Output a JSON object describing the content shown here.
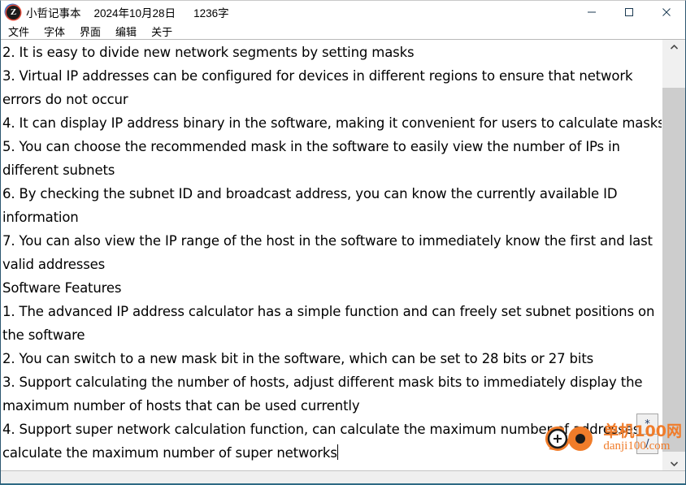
{
  "window": {
    "app_icon_letter": "Z",
    "title": "小哲记事本",
    "date": "2024年10月28日",
    "word_count": "1236字",
    "controls": {
      "minimize": "minimize-icon",
      "maximize": "maximize-icon",
      "close": "close-icon"
    }
  },
  "menubar": {
    "items": [
      {
        "label": "文件"
      },
      {
        "label": "字体"
      },
      {
        "label": "界面"
      },
      {
        "label": "编辑"
      },
      {
        "label": "关于"
      }
    ]
  },
  "editor": {
    "lines": [
      "2. It is easy to divide new network segments by setting masks",
      "3. Virtual IP addresses can be configured for devices in different regions to ensure that network",
      "errors do not occur",
      "4. It can display IP address binary in the software, making it convenient for users to calculate masks",
      "5. You can choose the recommended mask in the software to easily view the number of IPs in",
      "different subnets",
      "6. By checking the subnet ID and broadcast address, you can know the currently available ID",
      "information",
      "7. You can also view the IP range of the host in the software to immediately know the first and last",
      "valid addresses",
      "Software Features",
      "1. The advanced IP address calculator has a simple function and can freely set subnet positions on",
      "the software",
      "2. You can switch to a new mask bit in the software, which can be set to 28 bits or 27 bits",
      "3. Support calculating the number of hosts, adjust different mask bits to immediately display the",
      "maximum number of hosts that can be used currently",
      "4. Support super network calculation function, can calculate the maximum number of addresses,",
      "calculate the maximum number of super networks"
    ],
    "caret_line_index": 17
  },
  "scrollbar": {
    "up_arrow": "chevron-up-icon",
    "down_arrow": "chevron-down-icon"
  },
  "zoom_buttons": [
    {
      "label": "*",
      "name": "asterisk-button"
    },
    {
      "label": "/",
      "name": "slash-button"
    }
  ],
  "watermark": {
    "cn": "单机100网",
    "url": "danji100.com",
    "color": "#f07c2a"
  }
}
